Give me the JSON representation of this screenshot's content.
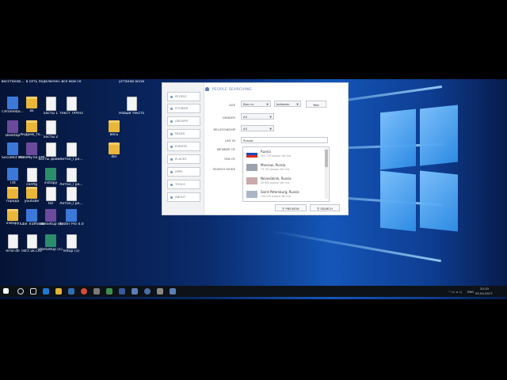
{
  "desktop": {
    "top_labels": [
      "восстанов...",
      "в сеть",
      "подключен...",
      "все мои се",
      "установ ассистен"
    ],
    "icons": [
      {
        "label": "Chromebo...",
        "kind": "app"
      },
      {
        "label": "ok",
        "kind": "folder"
      },
      {
        "label": "хосты 1",
        "kind": "file"
      },
      {
        "label": "текст ТРАНЗ",
        "kind": "file"
      },
      {
        "label": "Новый текстов...",
        "kind": "file"
      },
      {
        "label": "Desktop",
        "kind": "app2"
      },
      {
        "label": "Андрей_то...",
        "kind": "folder"
      },
      {
        "label": "хосты 2",
        "kind": "file"
      },
      {
        "label": "весь",
        "kind": "folder"
      },
      {
        "label": "SocialKit Pro",
        "kind": "app"
      },
      {
        "label": "HideMy.na VPN",
        "kind": "app2"
      },
      {
        "label": "хосты доки...",
        "kind": "file"
      },
      {
        "label": "Антон_Гро...",
        "kind": "file"
      },
      {
        "label": "dkr",
        "kind": "folder"
      },
      {
        "label": "TXt",
        "kind": "app"
      },
      {
        "label": "config",
        "kind": "file"
      },
      {
        "label": "instapy",
        "kind": "app3"
      },
      {
        "label": "Антон_Гро...",
        "kind": "file"
      },
      {
        "label": "города",
        "kind": "folder"
      },
      {
        "label": "youtube",
        "kind": "folder"
      },
      {
        "label": "txt",
        "kind": "file"
      },
      {
        "label": "Антон_Гро...",
        "kind": "file"
      },
      {
        "label": "instapy",
        "kind": "folder"
      },
      {
        "label": "Tube Traffic Bike",
        "kind": "app"
      },
      {
        "label": "VibeSetup (1)",
        "kind": "app2"
      },
      {
        "label": "Poster Pro 4.0",
        "kind": "app"
      },
      {
        "label": "error.dll",
        "kind": "file"
      },
      {
        "label": "list.t uk.csv",
        "kind": "file"
      },
      {
        "label": "VibeSetup (1).exe_par...",
        "kind": "app3"
      },
      {
        "label": "setup (1)",
        "kind": "file"
      }
    ]
  },
  "dialog": {
    "header": "PEOPLE SEARCHING",
    "nav": [
      "PEOPLE",
      "STORIES",
      "GROUPS",
      "PAGES",
      "EVENTS",
      "PLACES",
      "APPS",
      "TOOLS",
      "ABOUT"
    ],
    "labels": {
      "age": "AGE",
      "gender": "GENDER",
      "relationship": "RELATIONSHIP",
      "live_in": "LIVE IN",
      "member_of": "MEMBER OF",
      "fan_of": "FAN OF",
      "search_mode": "SEARCH MODE"
    },
    "age_from": "Born in",
    "age_to": "between",
    "year_btn": "Year",
    "gender_value": "All",
    "relationship_value": "All",
    "live_in_value": "Russia",
    "dropdown": [
      {
        "name": "Russia",
        "sub": "405 279 people like this"
      },
      {
        "name": "Moscow, Russia",
        "sub": "79 797 people like this"
      },
      {
        "name": "Novosibirsk, Russia",
        "sub": "26 862 people like this"
      },
      {
        "name": "Saint Petersburg, Russia",
        "sub": "256 020 people like this"
      }
    ],
    "preview_btn": "PREVIEW",
    "search_btn": "SEARCH"
  },
  "taskbar": {
    "lang": "ENG",
    "time": "20:10",
    "date": "05.04.2017"
  }
}
